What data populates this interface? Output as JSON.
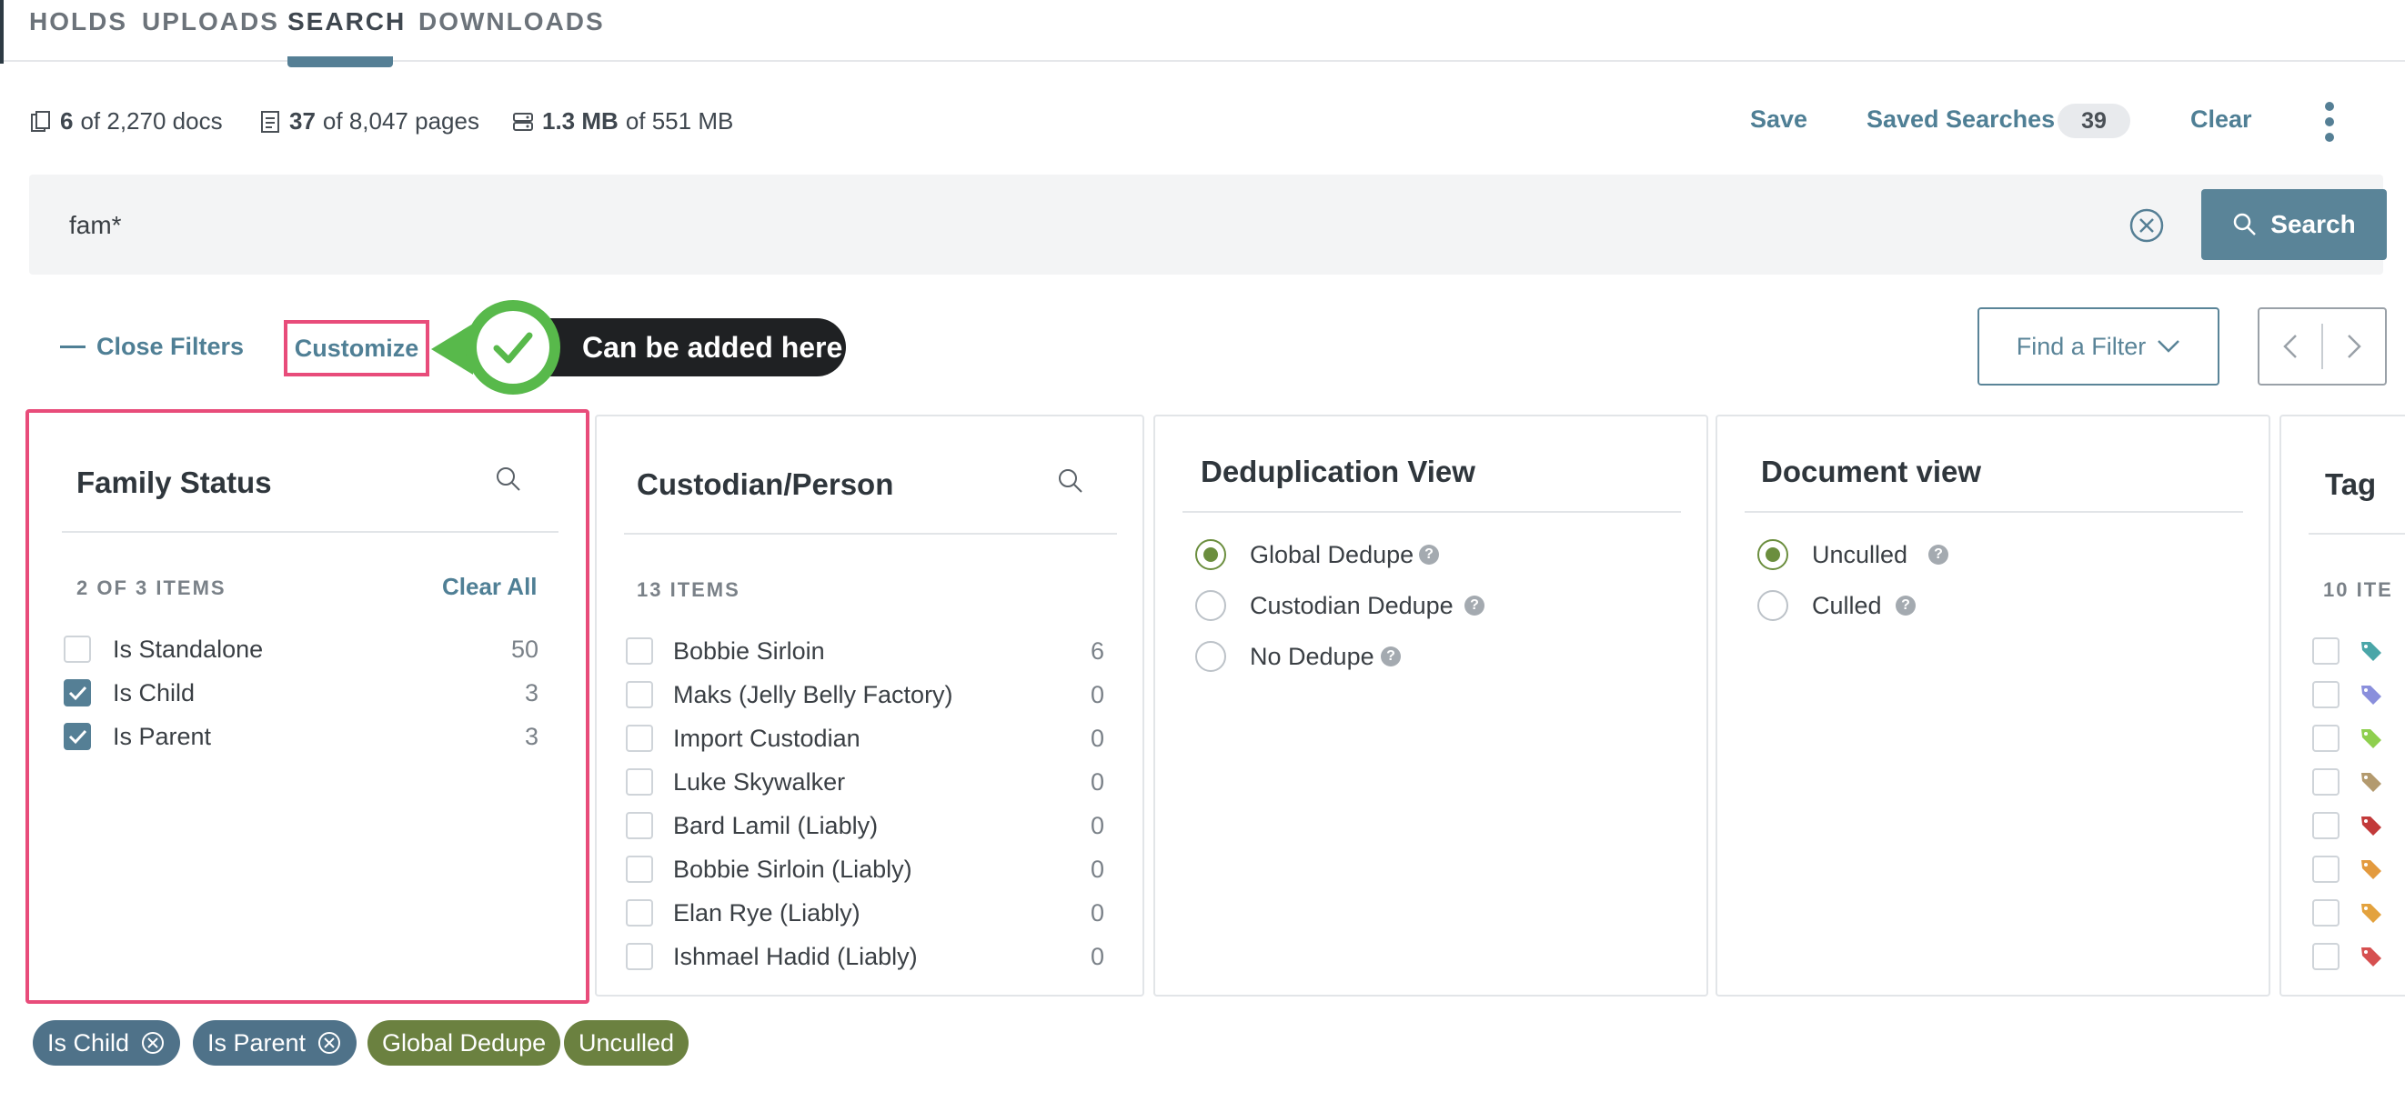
{
  "nav": {
    "tabs": [
      "HOLDS",
      "UPLOADS",
      "SEARCH",
      "DOWNLOADS"
    ],
    "active": "SEARCH"
  },
  "stats": {
    "docs_count": "6",
    "docs_total": "of 2,270 docs",
    "pages_count": "37",
    "pages_total": "of 8,047 pages",
    "size_count": "1.3 MB",
    "size_total": "of 551 MB"
  },
  "header_actions": {
    "save": "Save",
    "saved_searches": "Saved Searches",
    "saved_count": "39",
    "clear": "Clear"
  },
  "search": {
    "query": "fam*",
    "button": "Search"
  },
  "filters_bar": {
    "close_filters": "Close Filters",
    "customize": "Customize",
    "callout": "Can be added here",
    "find_filter": "Find a Filter"
  },
  "panels": {
    "family_status": {
      "title": "Family Status",
      "count": "2 OF 3 ITEMS",
      "clear_all": "Clear All",
      "items": [
        {
          "label": "Is Standalone",
          "count": "50",
          "checked": false
        },
        {
          "label": "Is Child",
          "count": "3",
          "checked": true
        },
        {
          "label": "Is Parent",
          "count": "3",
          "checked": true
        }
      ]
    },
    "custodian": {
      "title": "Custodian/Person",
      "count": "13 ITEMS",
      "items": [
        {
          "label": "Bobbie Sirloin",
          "count": "6"
        },
        {
          "label": "Maks (Jelly Belly Factory)",
          "count": "0"
        },
        {
          "label": "Import Custodian",
          "count": "0"
        },
        {
          "label": "Luke Skywalker",
          "count": "0"
        },
        {
          "label": "Bard Lamil (Liably)",
          "count": "0"
        },
        {
          "label": "Bobbie Sirloin (Liably)",
          "count": "0"
        },
        {
          "label": "Elan Rye (Liably)",
          "count": "0"
        },
        {
          "label": "Ishmael Hadid (Liably)",
          "count": "0"
        }
      ]
    },
    "dedup": {
      "title": "Deduplication View",
      "options": [
        {
          "label": "Global Dedupe",
          "selected": true
        },
        {
          "label": "Custodian Dedupe",
          "selected": false
        },
        {
          "label": "No Dedupe",
          "selected": false
        }
      ]
    },
    "docview": {
      "title": "Document view",
      "options": [
        {
          "label": "Unculled",
          "selected": true
        },
        {
          "label": "Culled",
          "selected": false
        }
      ]
    },
    "tag": {
      "title": "Tag",
      "count": "10 ITE",
      "tag_colors": [
        "#4aa6a8",
        "#8a8fdc",
        "#8fcf4f",
        "#b39a6e",
        "#c23a3a",
        "#e39a3e",
        "#e3a23e",
        "#d65050"
      ]
    }
  },
  "chips": [
    {
      "label": "Is Child",
      "removable": true,
      "color": "#4f7289"
    },
    {
      "label": "Is Parent",
      "removable": true,
      "color": "#4f7289"
    },
    {
      "label": "Global Dedupe",
      "removable": false,
      "color": "#6b8140"
    },
    {
      "label": "Unculled",
      "removable": false,
      "color": "#6b8140"
    }
  ]
}
